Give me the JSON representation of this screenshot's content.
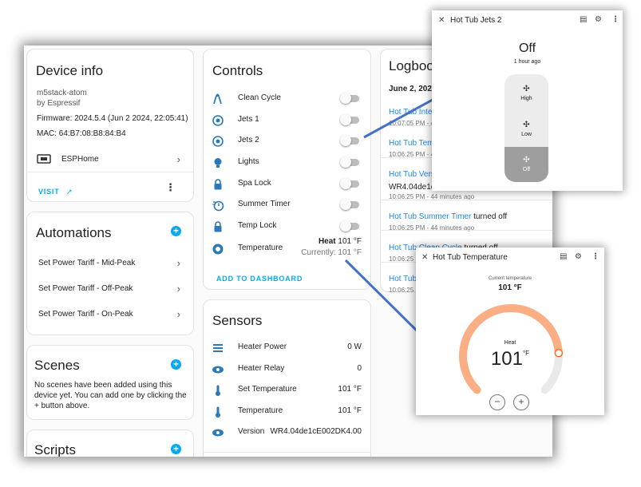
{
  "device_info": {
    "title": "Device info",
    "model": "m5stack-atom",
    "manufacturer": "by Espressif",
    "firmware": "Firmware: 2024.5.4 (Jun 2 2024, 22:05:41)",
    "mac": "MAC: 64:B7:08:B8:84:B4",
    "integration": "ESPHome",
    "visit_label": "VISIT"
  },
  "automations": {
    "title": "Automations",
    "items": [
      "Set Power Tariff - Mid-Peak",
      "Set Power Tariff - Off-Peak",
      "Set Power Tariff - On-Peak"
    ]
  },
  "scenes": {
    "title": "Scenes",
    "empty_text": "No scenes have been added using this device yet. You can add one by clicking the + button above."
  },
  "scripts": {
    "title": "Scripts"
  },
  "controls": {
    "title": "Controls",
    "items": [
      {
        "label": "Clean Cycle",
        "icon": "clean-cycle-icon",
        "state": "off"
      },
      {
        "label": "Jets 1",
        "icon": "jets-icon",
        "state": "off"
      },
      {
        "label": "Jets 2",
        "icon": "jets-icon",
        "state": "off"
      },
      {
        "label": "Lights",
        "icon": "lightbulb-icon",
        "state": "off"
      },
      {
        "label": "Spa Lock",
        "icon": "lock-icon",
        "state": "off"
      },
      {
        "label": "Summer Timer",
        "icon": "timer-icon",
        "state": "off"
      },
      {
        "label": "Temp Lock",
        "icon": "lock-icon",
        "state": "off"
      }
    ],
    "temperature": {
      "label": "Temperature",
      "mode": "Heat",
      "value": "101 °F",
      "current": "Currently: 101 °F"
    },
    "add_to_dashboard": "ADD TO DASHBOARD"
  },
  "sensors": {
    "title": "Sensors",
    "items": [
      {
        "label": "Heater Power",
        "value": "0 W",
        "icon": "heater-icon"
      },
      {
        "label": "Heater Relay",
        "value": "0",
        "icon": "eye-icon"
      },
      {
        "label": "Set Temperature",
        "value": "101 °F",
        "icon": "thermometer-icon"
      },
      {
        "label": "Temperature",
        "value": "101 °F",
        "icon": "thermometer-icon"
      },
      {
        "label": "Version",
        "value": "WR4.04de1cE002DK4.00",
        "icon": "eye-icon"
      }
    ]
  },
  "logbook": {
    "title": "Logbook",
    "date": "June 2, 2024",
    "entries": [
      {
        "link": "Hot Tub Inter",
        "text": "",
        "time": "10:07:05 PM - 44"
      },
      {
        "link": "Hot Tub Temp",
        "text": "",
        "time": "10:06:25 PM - 44"
      },
      {
        "link": "Hot Tub Versi",
        "text": "WR4.04de1c",
        "time": "10:06:25 PM - 44 minutes ago"
      },
      {
        "link": "Hot Tub Summer Timer",
        "text": " turned off",
        "time": "10:06:25 PM - 44 minutes ago"
      },
      {
        "link": "Hot Tub Clean Cycle",
        "text": " turned off",
        "time": "10:06:25 PM - 44"
      },
      {
        "link": "Hot Tub",
        "text": "",
        "time": "10:06:25 PM - 44"
      }
    ]
  },
  "jets_popup": {
    "title": "Hot Tub Jets 2",
    "state": "Off",
    "ago": "1 hour ago",
    "options": [
      "High",
      "Low",
      "Off"
    ],
    "selected": "Off"
  },
  "temp_popup": {
    "title": "Hot Tub Temperature",
    "current_label": "Current temperature",
    "current_value": "101 °F",
    "mode": "Heat",
    "target": "101",
    "unit": "°F",
    "minus": "−",
    "plus": "+",
    "setpoint_fraction": 0.82
  },
  "colors": {
    "accent": "#03a9f4",
    "heat_arc": "#fbae84",
    "heat_knob": "#ff6f22",
    "connector": "#4472c4"
  }
}
